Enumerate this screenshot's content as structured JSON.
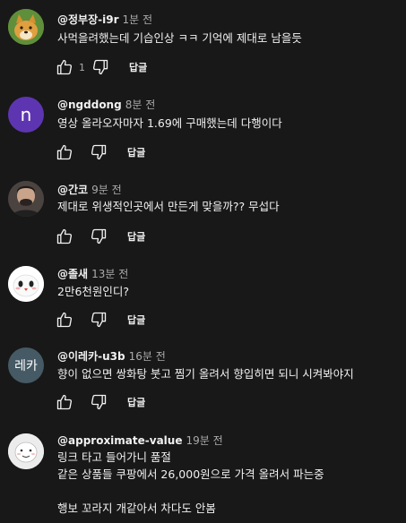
{
  "comments": [
    {
      "author": "@정부장-i9r",
      "time": "1분 전",
      "text": "사먹을려했는데 기습인상 ㅋㅋ 기억에 제대로 남을듯",
      "likes": "1",
      "reply_label": "답글",
      "avatar": "doge-dog-avatar"
    },
    {
      "author": "@ngddong",
      "time": "8분 전",
      "text": "영상 올라오자마자 1.69에 구매했는데 다행이다",
      "likes": "",
      "reply_label": "답글",
      "avatar_letter": "n",
      "avatar_color": "#5e35b1"
    },
    {
      "author": "@간코",
      "time": "9분 전",
      "text": "제대로 위생적인곳에서 만든게 맞을까?? 무섭다",
      "likes": "",
      "reply_label": "답글",
      "avatar": "man-photo-avatar"
    },
    {
      "author": "@졸새",
      "time": "13분 전",
      "text": "2만6천원인디?",
      "likes": "",
      "reply_label": "답글",
      "avatar": "white-bird-avatar"
    },
    {
      "author": "@이레카-u3b",
      "time": "16분 전",
      "text": "향이 없으면 쌍화탕 붓고 찜기 올려서 향입히면 되니 시켜봐야지",
      "likes": "",
      "reply_label": "답글",
      "avatar_letter": "레카",
      "avatar_color": "#455a64"
    },
    {
      "author": "@approximate-value",
      "time": "19분 전",
      "text": "링크 타고 들어가니 품절\n같은 상품들 쿠팡에서 26,000원으로 가격 올려서 파는중\n\n행보 꼬라지 개같아서 차다도 안봄",
      "likes": "",
      "reply_label": "",
      "avatar": "cartoon-face-avatar"
    }
  ],
  "colors": {
    "background": "#181818",
    "text_primary": "#f1f1f1",
    "text_secondary": "#aaaaaa"
  }
}
